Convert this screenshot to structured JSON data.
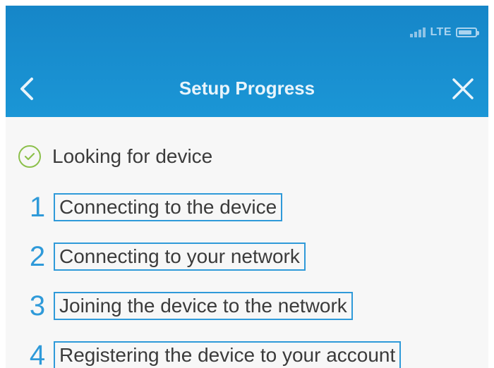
{
  "status_bar": {
    "network_label": "LTE"
  },
  "header": {
    "title": "Setup Progress"
  },
  "icons": {
    "back": "chevron-left-icon",
    "close": "close-icon",
    "check": "check-circle-icon"
  },
  "colors": {
    "header": "#1b96d6",
    "accent": "#2f9ad9",
    "check": "#8cc04b"
  },
  "completed_step": {
    "label": "Looking for device"
  },
  "steps": [
    {
      "number": "1",
      "label": "Connecting to the device"
    },
    {
      "number": "2",
      "label": "Connecting to your network"
    },
    {
      "number": "3",
      "label": "Joining the device to the network"
    },
    {
      "number": "4",
      "label": "Registering the device to your account"
    }
  ]
}
